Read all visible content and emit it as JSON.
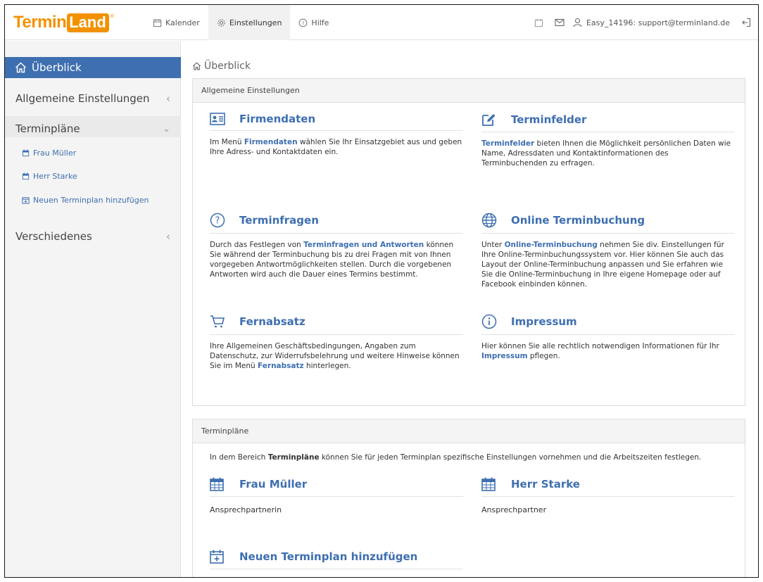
{
  "header": {
    "logo_text": "Termin",
    "logo_badge": "Land",
    "logo_reg": "®",
    "nav": [
      {
        "label": "Kalender",
        "icon": "calendar-icon"
      },
      {
        "label": "Einstellungen",
        "icon": "gear-icon",
        "active": true
      },
      {
        "label": "Hilfe",
        "icon": "help-circle-icon"
      }
    ],
    "user_label": "Easy_14196: support@terminland.de"
  },
  "sidebar": {
    "active_label": "Überblick",
    "sections": [
      {
        "label": "Allgemeine Einstellungen",
        "chevron": "‹"
      },
      {
        "label": "Terminpläne",
        "chevron": "⌄"
      },
      {
        "label": "Verschiedenes",
        "chevron": "‹"
      }
    ],
    "sub_items": [
      {
        "label": "Frau Müller"
      },
      {
        "label": "Herr Starke"
      },
      {
        "label": "Neuen Terminplan hinzufügen"
      }
    ]
  },
  "breadcrumb": "Überblick",
  "general_panel": {
    "title": "Allgemeine Einstellungen",
    "tiles": [
      {
        "title": "Firmendaten",
        "icon": "contact-card-icon",
        "body": [
          {
            "t": "Im Menü "
          },
          {
            "t": "Firmendaten",
            "link": true
          },
          {
            "t": " wählen Sie Ihr Einsatzgebiet aus und geben Ihre Adress- und Kontaktdaten ein."
          }
        ]
      },
      {
        "title": "Terminfelder",
        "icon": "edit-icon",
        "body": [
          {
            "t": "Terminfelder",
            "link": true
          },
          {
            "t": " bieten Ihnen die Möglichkeit persönlichen Daten wie Name, Adressdaten und Kontaktinformationen des Terminbuchenden zu erfragen."
          }
        ]
      },
      {
        "title": "Terminfragen",
        "icon": "question-circle-icon",
        "body": [
          {
            "t": "Durch das Festlegen von "
          },
          {
            "t": "Terminfragen und Antworten",
            "link": true
          },
          {
            "t": " können Sie während der Terminbuchung bis zu drei Fragen mit von Ihnen vorgegeben Antwortmöglichkeiten stellen. Durch die vorgebenen Antworten wird auch die Dauer eines Termins bestimmt."
          }
        ]
      },
      {
        "title": "Online Terminbuchung",
        "icon": "globe-icon",
        "body": [
          {
            "t": "Unter "
          },
          {
            "t": "Online-Terminbuchung",
            "link": true
          },
          {
            "t": " nehmen Sie div. Einstellungen für Ihre Online-Terminbuchungssystem vor. Hier können Sie auch das Layout der Online-Terminbuchung anpassen und Sie erfahren wie Sie die Online-Terminbuchung in Ihre eigene Homepage oder auf Facebook einbinden können."
          }
        ]
      },
      {
        "title": "Fernabsatz",
        "icon": "cart-icon",
        "body": [
          {
            "t": "Ihre Allgemeinen Geschäftsbedingungen, Angaben zum Datenschutz, zur Widerrufsbelehrung und weitere Hinweise können Sie im Menü "
          },
          {
            "t": "Fernabsatz",
            "link": true
          },
          {
            "t": " hinterlegen."
          }
        ]
      },
      {
        "title": "Impressum",
        "icon": "info-circle-icon",
        "body": [
          {
            "t": "Hier können Sie alle rechtlich notwendigen Informationen für Ihr "
          },
          {
            "t": "Impressum",
            "link": true
          },
          {
            "t": " pflegen."
          }
        ]
      }
    ]
  },
  "plans_panel": {
    "title": "Terminpläne",
    "intro": [
      {
        "t": "In dem Bereich "
      },
      {
        "t": "Terminpläne",
        "bold": true
      },
      {
        "t": " können Sie für jeden Terminplan spezifische Einstellungen vornehmen und die Arbeitszeiten festlegen."
      }
    ],
    "plans": [
      {
        "title": "Frau Müller",
        "sub": "Ansprechpartnerin",
        "icon": "calendar-icon"
      },
      {
        "title": "Herr Starke",
        "sub": "Ansprechpartner",
        "icon": "calendar-icon"
      },
      {
        "title": "Neuen Terminplan hinzufügen",
        "sub": "",
        "icon": "calendar-add-icon"
      }
    ]
  },
  "colors": {
    "accent": "#3e6fb0",
    "logo": "#f39200"
  }
}
